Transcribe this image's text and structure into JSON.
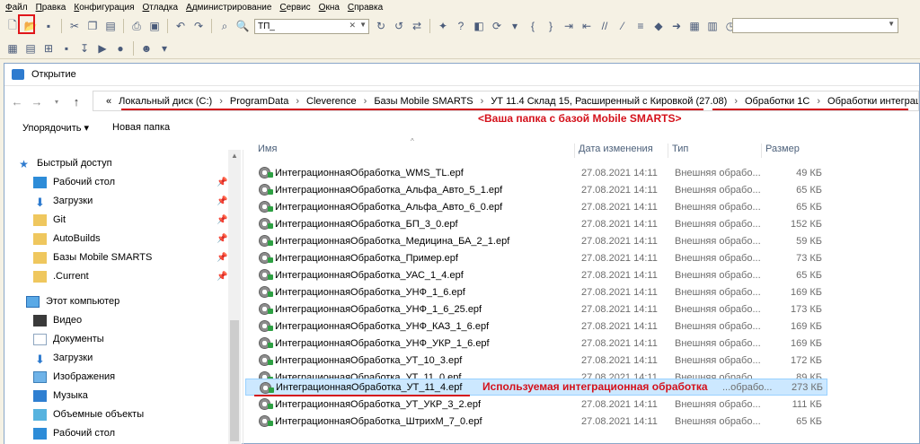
{
  "menu": [
    "Файл",
    "Правка",
    "Конфигурация",
    "Отладка",
    "Администрирование",
    "Сервис",
    "Окна",
    "Справка"
  ],
  "toolbar": {
    "search_value": "ТП_"
  },
  "dialog": {
    "title": "Открытие",
    "address": [
      "«",
      "Локальный диск (C:)",
      "ProgramData",
      "Cleverence",
      "Базы Mobile SMARTS",
      "УТ 11.4 Склад 15, Расширенный с Кировкой (27.08)",
      "Обработки 1С",
      "Обработки интеграции"
    ],
    "hint_folder": "<Ваша папка с базой Mobile SMARTS>",
    "organize_label": "Упорядочить ▾",
    "new_folder_label": "Новая папка",
    "columns": {
      "name": "Имя",
      "date": "Дата изменения",
      "type": "Тип",
      "size": "Размер"
    },
    "nav": [
      {
        "label": "Быстрый доступ",
        "icon": "star-icon"
      },
      {
        "label": "Рабочий стол",
        "icon": "desktop-folder-icon",
        "pin": true
      },
      {
        "label": "Загрузки",
        "icon": "download-icon",
        "pin": true
      },
      {
        "label": "Git",
        "icon": "folder-icon",
        "pin": true
      },
      {
        "label": "AutoBuilds",
        "icon": "folder-icon",
        "pin": true
      },
      {
        "label": "Базы Mobile SMARTS",
        "icon": "folder-icon",
        "pin": true
      },
      {
        "label": ".Current",
        "icon": "folder-icon",
        "pin": true
      },
      {
        "label": "Этот компьютер",
        "icon": "computer-icon"
      },
      {
        "label": "Видео",
        "icon": "video-icon"
      },
      {
        "label": "Документы",
        "icon": "documents-icon"
      },
      {
        "label": "Загрузки",
        "icon": "download-icon"
      },
      {
        "label": "Изображения",
        "icon": "images-icon"
      },
      {
        "label": "Музыка",
        "icon": "music-icon"
      },
      {
        "label": "Объемные объекты",
        "icon": "3d-objects-icon"
      },
      {
        "label": "Рабочий стол",
        "icon": "desktop-icon"
      }
    ],
    "files": [
      {
        "name": "ИнтеграционнаяОбработка_WMS_TL.epf",
        "date": "27.08.2021 14:11",
        "type": "Внешняя обрабо...",
        "size": "49 КБ"
      },
      {
        "name": "ИнтеграционнаяОбработка_Альфа_Авто_5_1.epf",
        "date": "27.08.2021 14:11",
        "type": "Внешняя обрабо...",
        "size": "65 КБ"
      },
      {
        "name": "ИнтеграционнаяОбработка_Альфа_Авто_6_0.epf",
        "date": "27.08.2021 14:11",
        "type": "Внешняя обрабо...",
        "size": "65 КБ"
      },
      {
        "name": "ИнтеграционнаяОбработка_БП_3_0.epf",
        "date": "27.08.2021 14:11",
        "type": "Внешняя обрабо...",
        "size": "152 КБ"
      },
      {
        "name": "ИнтеграционнаяОбработка_Медицина_БА_2_1.epf",
        "date": "27.08.2021 14:11",
        "type": "Внешняя обрабо...",
        "size": "59 КБ"
      },
      {
        "name": "ИнтеграционнаяОбработка_Пример.epf",
        "date": "27.08.2021 14:11",
        "type": "Внешняя обрабо...",
        "size": "73 КБ"
      },
      {
        "name": "ИнтеграционнаяОбработка_УАС_1_4.epf",
        "date": "27.08.2021 14:11",
        "type": "Внешняя обрабо...",
        "size": "65 КБ"
      },
      {
        "name": "ИнтеграционнаяОбработка_УНФ_1_6.epf",
        "date": "27.08.2021 14:11",
        "type": "Внешняя обрабо...",
        "size": "169 КБ"
      },
      {
        "name": "ИнтеграционнаяОбработка_УНФ_1_6_25.epf",
        "date": "27.08.2021 14:11",
        "type": "Внешняя обрабо...",
        "size": "173 КБ"
      },
      {
        "name": "ИнтеграционнаяОбработка_УНФ_КАЗ_1_6.epf",
        "date": "27.08.2021 14:11",
        "type": "Внешняя обрабо...",
        "size": "169 КБ"
      },
      {
        "name": "ИнтеграционнаяОбработка_УНФ_УКР_1_6.epf",
        "date": "27.08.2021 14:11",
        "type": "Внешняя обрабо...",
        "size": "169 КБ"
      },
      {
        "name": "ИнтеграционнаяОбработка_УТ_10_3.epf",
        "date": "27.08.2021 14:11",
        "type": "Внешняя обрабо...",
        "size": "172 КБ"
      },
      {
        "name": "ИнтеграционнаяОбработка_УТ_11_0.epf",
        "date": "27.08.2021 14:11",
        "type": "Внешняя обрабо...",
        "size": "89 КБ"
      },
      {
        "name": "ИнтеграционнаяОбработка_УТ_11_4.epf",
        "date": "",
        "type": "...обрабо...",
        "size": "273 КБ",
        "selected": true
      },
      {
        "name": "ИнтеграционнаяОбработка_УТ_УКР_3_2.epf",
        "date": "27.08.2021 14:11",
        "type": "Внешняя обрабо...",
        "size": "111 КБ"
      },
      {
        "name": "ИнтеграционнаяОбработка_ШтрихМ_7_0.epf",
        "date": "27.08.2021 14:11",
        "type": "Внешняя обрабо...",
        "size": "65 КБ"
      }
    ],
    "hint_file": "Используемая интеграционная обработка"
  }
}
